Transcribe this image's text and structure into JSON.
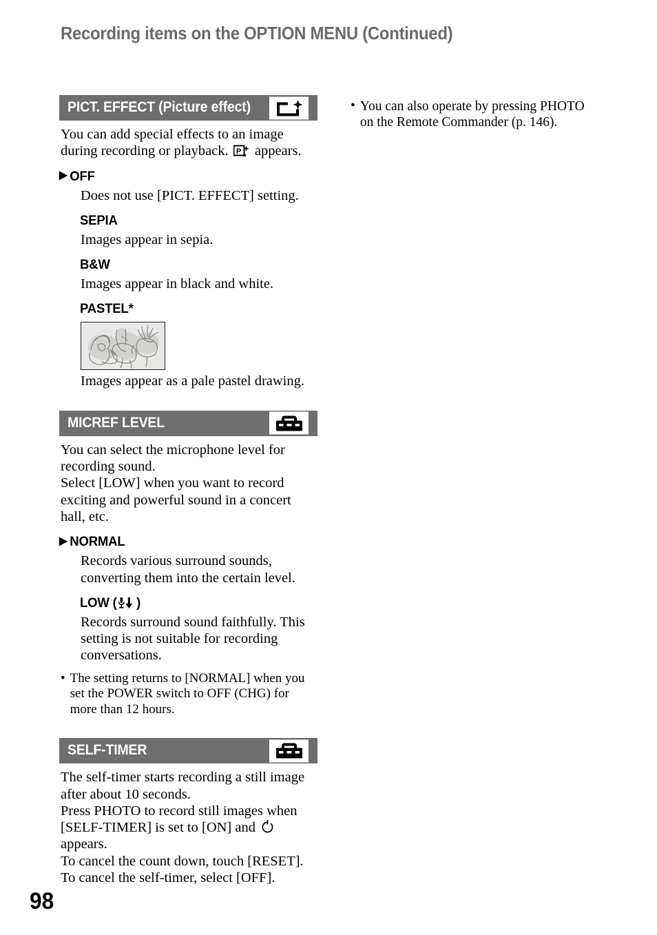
{
  "page": {
    "header_title": "Recording items on the OPTION MENU (Continued)",
    "page_number": "98",
    "bar_color": "#6e6e6e"
  },
  "sections": [
    {
      "id": "pict-effect",
      "title": "PICT. EFFECT (Picture effect)",
      "icon": "picture-effect-icon",
      "intro_a": "You can add special effects to an image during recording or playback.",
      "intro_icon": "p-star-icon",
      "intro_b": "appears.",
      "options": [
        {
          "marker": "▶",
          "label": "OFF",
          "desc": "Does not use [PICT. EFFECT] setting."
        },
        {
          "marker": "",
          "label": "SEPIA",
          "desc": "Images appear in sepia."
        },
        {
          "marker": "",
          "label": "B&W",
          "desc": "Images appear in black and white."
        },
        {
          "marker": "",
          "label": "PASTEL*",
          "desc": "Images appear as a pale pastel drawing.",
          "sample_image": "pastel-flower-sketch"
        }
      ]
    },
    {
      "id": "micref-level",
      "title": "MICREF LEVEL",
      "icon": "toolbox-icon",
      "intro_a": "You can select the microphone level for recording sound.",
      "intro_b": "Select [LOW] when you want to record exciting and powerful sound in a concert hall, etc.",
      "options": [
        {
          "marker": "▶",
          "label": "NORMAL",
          "desc": "Records various surround sounds, converting them into the certain level."
        },
        {
          "marker": "",
          "label_pre": "LOW (",
          "label_post": ")",
          "label_icon": "mic-low-icon",
          "desc": "Records surround sound faithfully. This setting is not suitable for recording conversations."
        }
      ],
      "note": "The setting returns to [NORMAL] when you set the POWER switch to OFF (CHG) for more than 12 hours."
    },
    {
      "id": "self-timer",
      "title": "SELF-TIMER",
      "icon": "toolbox-icon",
      "body_lines": [
        "The self-timer starts recording a still image after about 10 seconds.",
        "Press PHOTO to record still images when [SELF-TIMER] is set to [ON] and",
        "appears.",
        "To cancel the count down, touch [RESET].",
        "To cancel the self-timer, select [OFF]."
      ],
      "inline_icon": "self-timer-icon"
    }
  ],
  "right_column": {
    "notes": [
      {
        "bullet": "•",
        "text": "You can also operate by pressing PHOTO on the Remote Commander (p. 146)."
      }
    ]
  }
}
